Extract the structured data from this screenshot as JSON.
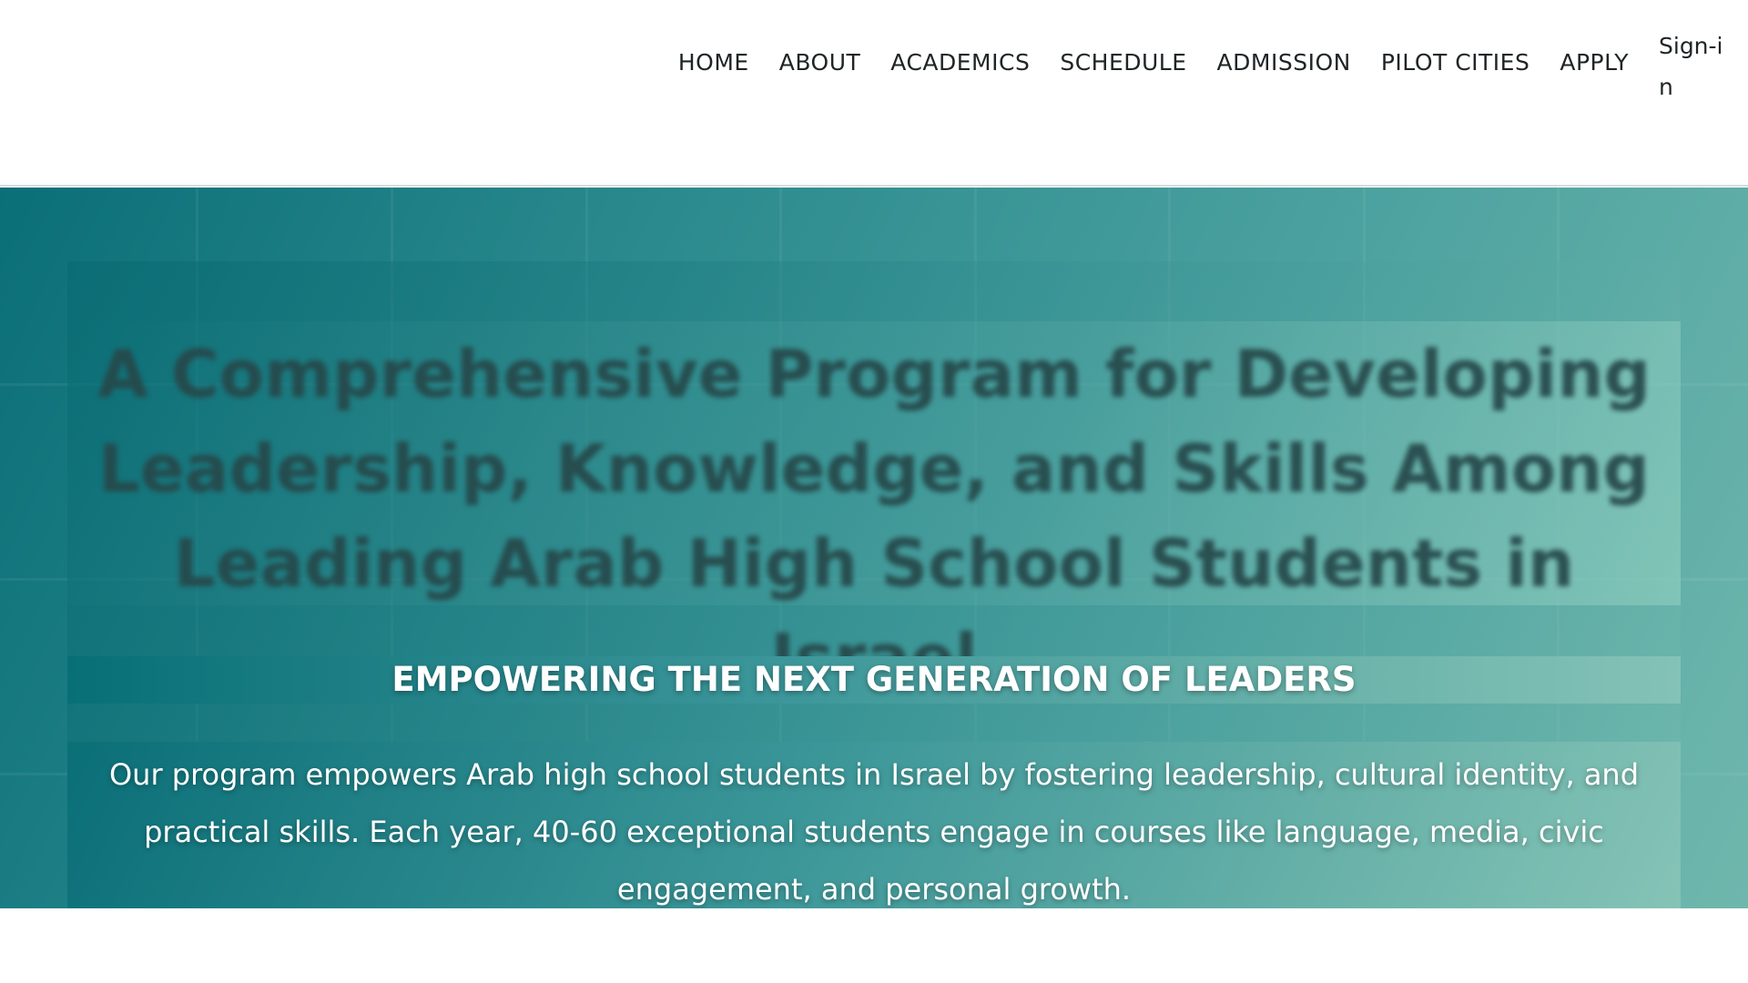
{
  "nav": {
    "items": [
      {
        "label": "HOME"
      },
      {
        "label": "ABOUT"
      },
      {
        "label": "ACADEMICS"
      },
      {
        "label": "SCHEDULE"
      },
      {
        "label": "ADMISSION"
      },
      {
        "label": "PILOT CITIES"
      },
      {
        "label": "APPLY"
      }
    ],
    "signin_label": "Sign-in"
  },
  "hero": {
    "headline": "A Comprehensive Program for Developing Leadership, Knowledge, and Skills Among Leading Arab High School Students in Israel",
    "tagline": "EMPOWERING THE NEXT GENERATION OF LEADERS",
    "description": "Our program empowers Arab high school students in Israel by fostering leadership, cultural identity, and practical skills. Each year, 40-60 exceptional students engage in courses like language, media, civic engagement, and personal growth."
  },
  "colors": {
    "accent_dark_teal": "#0b6f78",
    "accent_light_teal": "#84c2b7",
    "nav_text": "#1f2426"
  }
}
